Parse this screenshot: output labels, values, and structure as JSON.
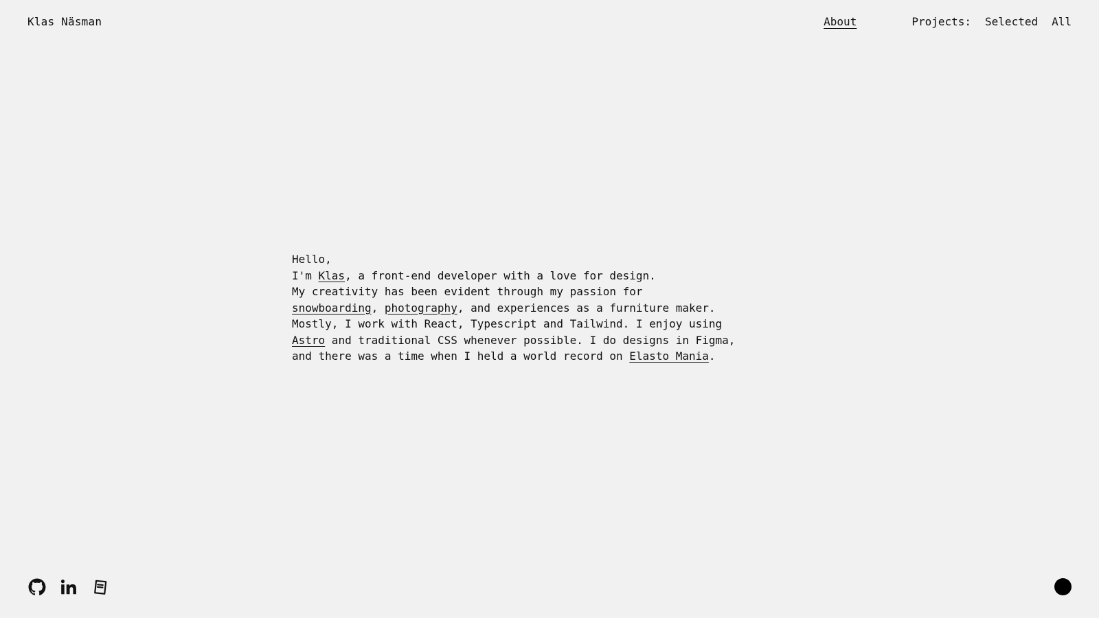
{
  "header": {
    "site_name": "Klas Näsman",
    "nav": {
      "about": "About",
      "projects_label": "Projects:",
      "selected": "Selected",
      "all": "All"
    }
  },
  "intro": {
    "greeting": "Hello,",
    "line2_pre": "I'm ",
    "line2_link": "Klas",
    "line2_post": ", a front-end developer with a love for design.",
    "line3": "My creativity has been evident through my passion for",
    "line4_link1": "snowboarding",
    "line4_sep": ", ",
    "line4_link2": "photography",
    "line4_post": ", and experiences as a furniture maker.",
    "line5": "Mostly, I work with React, Typescript and Tailwind. I enjoy using",
    "line6_link": "Astro",
    "line6_post": " and traditional CSS whenever possible. I do designs in Figma,",
    "line7_pre": "and there was a time when I held a world record on ",
    "line7_link": "Elasto Mania",
    "line7_post": "."
  },
  "footer": {
    "icons": [
      "github-icon",
      "linkedin-icon",
      "resume-icon",
      "theme-toggle-icon"
    ],
    "theme_color": "#000000"
  },
  "colors": {
    "background": "#f1f1f1",
    "text": "#111111"
  }
}
